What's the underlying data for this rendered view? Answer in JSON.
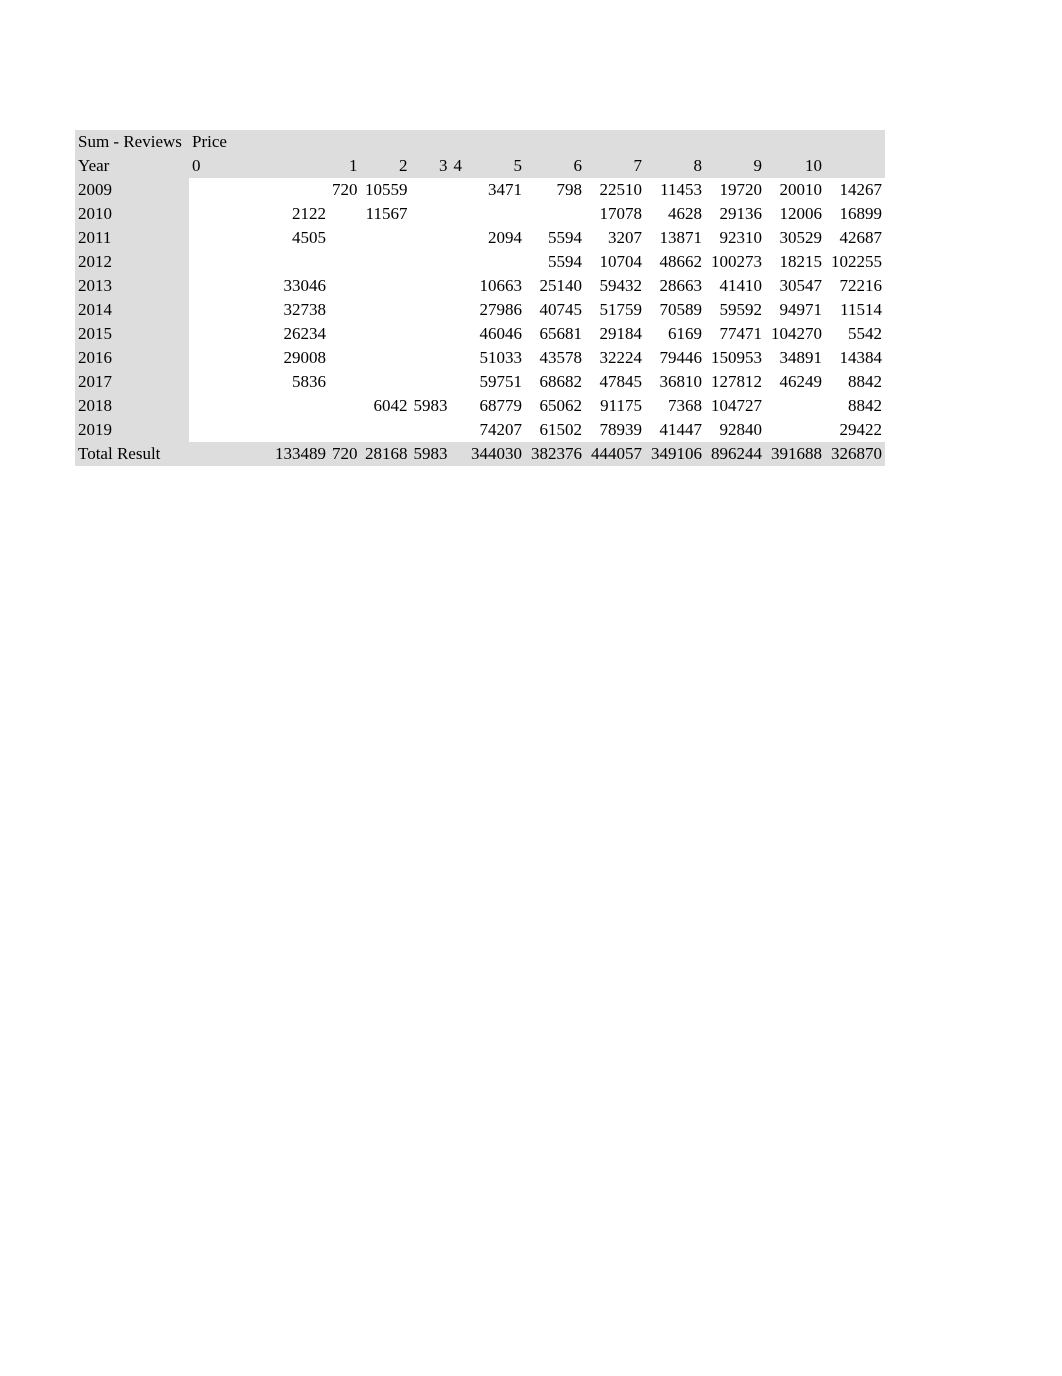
{
  "pivot": {
    "measure_label": "Sum - Reviews",
    "column_field_label": "Price",
    "row_field_label": "Year",
    "total_label": "Total Result",
    "columns": [
      "0",
      "1",
      "2",
      "3",
      "4",
      "5",
      "6",
      "7",
      "8",
      "9",
      "10"
    ],
    "rows": [
      {
        "label": "2009",
        "values": [
          "",
          "720",
          "10559",
          "",
          "",
          "3471",
          "798",
          "22510",
          "11453",
          "19720",
          "20010",
          "14267"
        ]
      },
      {
        "label": "2010",
        "values": [
          "2122",
          "",
          "11567",
          "",
          "",
          "",
          "",
          "17078",
          "4628",
          "29136",
          "12006",
          "16899"
        ]
      },
      {
        "label": "2011",
        "values": [
          "4505",
          "",
          "",
          "",
          "",
          "2094",
          "5594",
          "3207",
          "13871",
          "92310",
          "30529",
          "42687"
        ]
      },
      {
        "label": "2012",
        "values": [
          "",
          "",
          "",
          "",
          "",
          "",
          "5594",
          "10704",
          "48662",
          "100273",
          "18215",
          "102255"
        ]
      },
      {
        "label": "2013",
        "values": [
          "33046",
          "",
          "",
          "",
          "",
          "10663",
          "25140",
          "59432",
          "28663",
          "41410",
          "30547",
          "72216"
        ]
      },
      {
        "label": "2014",
        "values": [
          "32738",
          "",
          "",
          "",
          "",
          "27986",
          "40745",
          "51759",
          "70589",
          "59592",
          "94971",
          "11514"
        ]
      },
      {
        "label": "2015",
        "values": [
          "26234",
          "",
          "",
          "",
          "",
          "46046",
          "65681",
          "29184",
          "6169",
          "77471",
          "104270",
          "5542"
        ]
      },
      {
        "label": "2016",
        "values": [
          "29008",
          "",
          "",
          "",
          "",
          "51033",
          "43578",
          "32224",
          "79446",
          "150953",
          "34891",
          "14384"
        ]
      },
      {
        "label": "2017",
        "values": [
          "5836",
          "",
          "",
          "",
          "",
          "59751",
          "68682",
          "47845",
          "36810",
          "127812",
          "46249",
          "8842"
        ]
      },
      {
        "label": "2018",
        "values": [
          "",
          "",
          "6042",
          "5983",
          "",
          "68779",
          "65062",
          "91175",
          "7368",
          "104727",
          "",
          "8842"
        ]
      },
      {
        "label": "2019",
        "values": [
          "",
          "",
          "",
          "",
          "",
          "74207",
          "61502",
          "78939",
          "41447",
          "92840",
          "",
          "29422"
        ]
      }
    ],
    "totals": [
      "133489",
      "720",
      "28168",
      "5983",
      "",
      "344030",
      "382376",
      "444057",
      "349106",
      "896244",
      "391688",
      "326870"
    ]
  },
  "chart_data": {
    "type": "table",
    "title": "Sum - Reviews by Year and Price",
    "row_field": "Year",
    "column_field": "Price",
    "columns": [
      0,
      1,
      2,
      3,
      4,
      5,
      6,
      7,
      8,
      9,
      10
    ],
    "series": [
      {
        "name": "2009",
        "values": [
          null,
          720,
          10559,
          null,
          null,
          3471,
          798,
          22510,
          11453,
          19720,
          20010,
          14267
        ]
      },
      {
        "name": "2010",
        "values": [
          2122,
          null,
          11567,
          null,
          null,
          null,
          null,
          17078,
          4628,
          29136,
          12006,
          16899
        ]
      },
      {
        "name": "2011",
        "values": [
          4505,
          null,
          null,
          null,
          null,
          2094,
          5594,
          3207,
          13871,
          92310,
          30529,
          42687
        ]
      },
      {
        "name": "2012",
        "values": [
          null,
          null,
          null,
          null,
          null,
          null,
          5594,
          10704,
          48662,
          100273,
          18215,
          102255
        ]
      },
      {
        "name": "2013",
        "values": [
          33046,
          null,
          null,
          null,
          null,
          10663,
          25140,
          59432,
          28663,
          41410,
          30547,
          72216
        ]
      },
      {
        "name": "2014",
        "values": [
          32738,
          null,
          null,
          null,
          null,
          27986,
          40745,
          51759,
          70589,
          59592,
          94971,
          11514
        ]
      },
      {
        "name": "2015",
        "values": [
          26234,
          null,
          null,
          null,
          null,
          46046,
          65681,
          29184,
          6169,
          77471,
          104270,
          5542
        ]
      },
      {
        "name": "2016",
        "values": [
          29008,
          null,
          null,
          null,
          null,
          51033,
          43578,
          32224,
          79446,
          150953,
          34891,
          14384
        ]
      },
      {
        "name": "2017",
        "values": [
          5836,
          null,
          null,
          null,
          null,
          59751,
          68682,
          47845,
          36810,
          127812,
          46249,
          8842
        ]
      },
      {
        "name": "2018",
        "values": [
          null,
          null,
          6042,
          5983,
          null,
          68779,
          65062,
          91175,
          7368,
          104727,
          null,
          8842
        ]
      },
      {
        "name": "2019",
        "values": [
          null,
          null,
          null,
          null,
          null,
          74207,
          61502,
          78939,
          41447,
          92840,
          null,
          29422
        ]
      }
    ],
    "totals": [
      133489,
      720,
      28168,
      5983,
      null,
      344030,
      382376,
      444057,
      349106,
      896244,
      391688,
      326870
    ]
  }
}
